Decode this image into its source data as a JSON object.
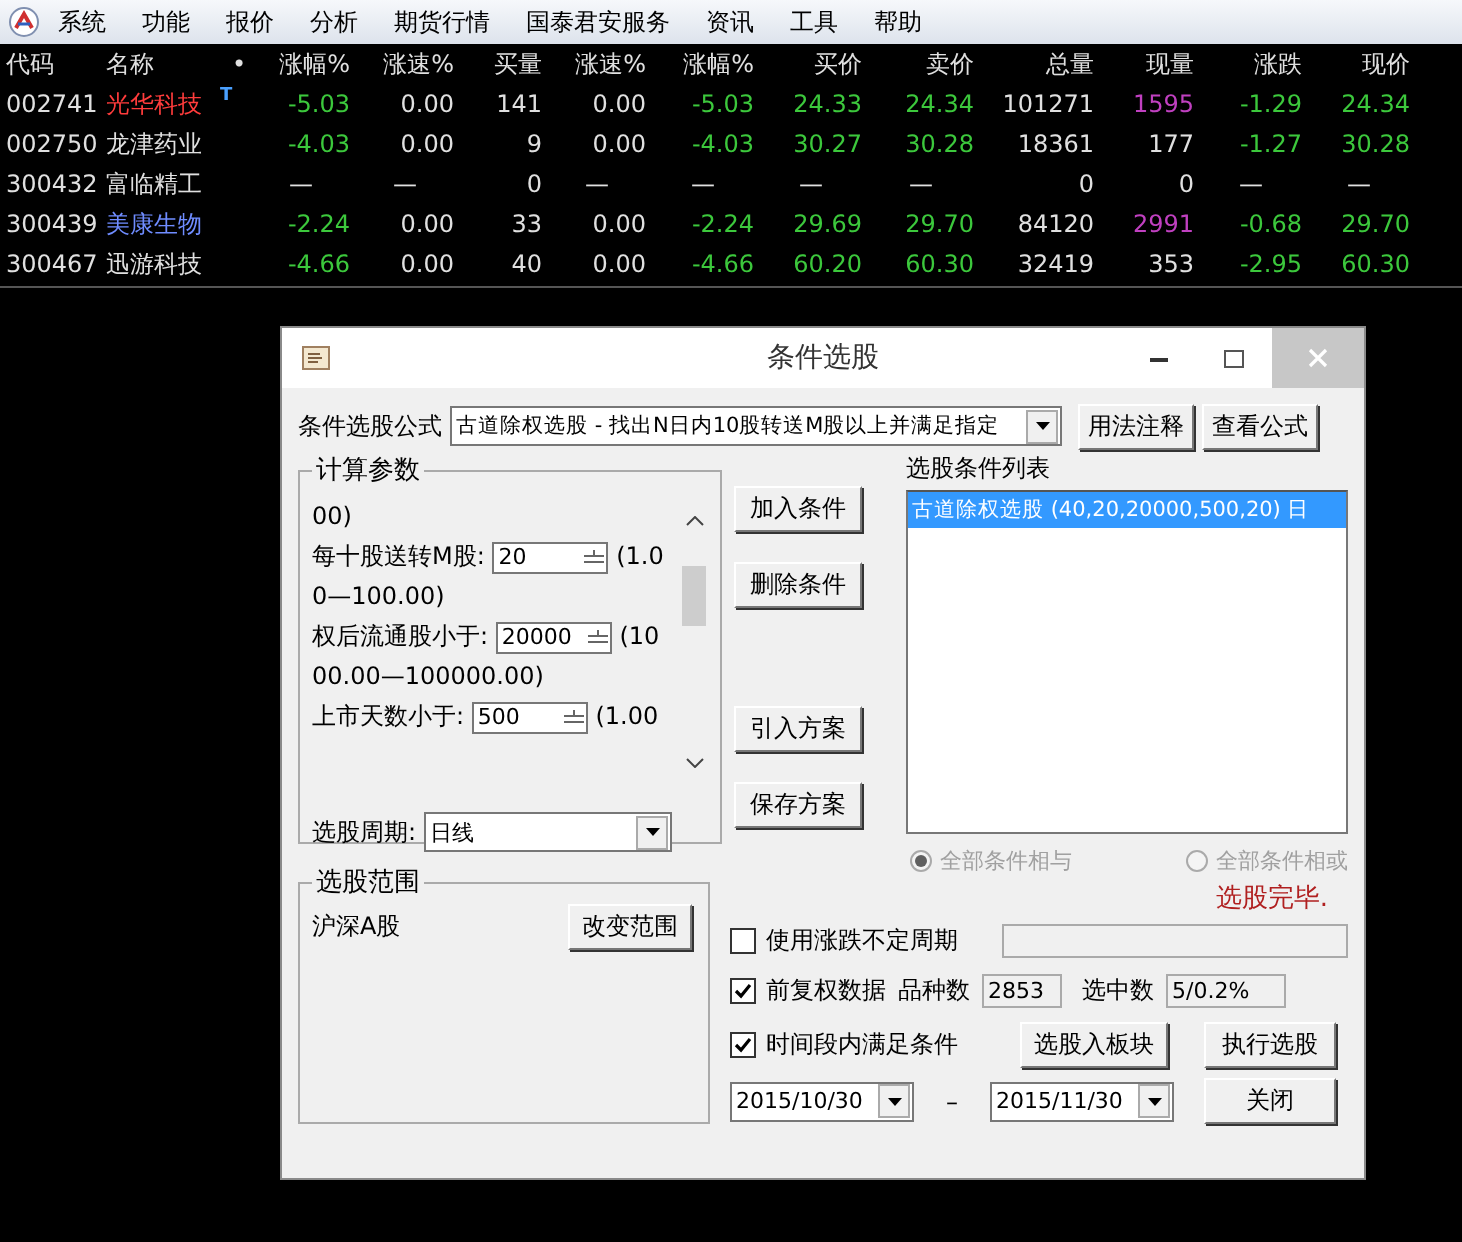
{
  "menu": [
    "系统",
    "功能",
    "报价",
    "分析",
    "期货行情",
    "国泰君安服务",
    "资讯",
    "工具",
    "帮助"
  ],
  "table": {
    "columns": [
      "代码",
      "名称",
      "•",
      "涨幅%",
      "涨速%",
      "买量",
      "涨速%",
      "涨幅%",
      "买价",
      "卖价",
      "总量",
      "现量",
      "涨跌",
      "现价"
    ],
    "rows": [
      {
        "color": "#ff3c3c",
        "cells": [
          {
            "text": "002741",
            "kind": "code"
          },
          {
            "text": "光华科技",
            "kind": "name"
          },
          {
            "text": "T",
            "kind": "flag"
          },
          {
            "text": "-5.03",
            "kind": "fall"
          },
          {
            "text": "0.00",
            "kind": "plain"
          },
          {
            "text": "141",
            "kind": "plain"
          },
          {
            "text": "0.00",
            "kind": "plain"
          },
          {
            "text": "-5.03",
            "kind": "fall"
          },
          {
            "text": "24.33",
            "kind": "fall"
          },
          {
            "text": "24.34",
            "kind": "fall"
          },
          {
            "text": "101271",
            "kind": "plain"
          },
          {
            "text": "1595",
            "kind": "volume"
          },
          {
            "text": "-1.29",
            "kind": "fall"
          },
          {
            "text": "24.34",
            "kind": "fall"
          }
        ]
      },
      {
        "color": "#e0e0e0",
        "cells": [
          {
            "text": "002750",
            "kind": "code"
          },
          {
            "text": "龙津药业",
            "kind": "name"
          },
          {
            "text": ""
          },
          {
            "text": "-4.03",
            "kind": "fall"
          },
          {
            "text": "0.00",
            "kind": "plain"
          },
          {
            "text": "9",
            "kind": "plain"
          },
          {
            "text": "0.00",
            "kind": "plain"
          },
          {
            "text": "-4.03",
            "kind": "fall"
          },
          {
            "text": "30.27",
            "kind": "fall"
          },
          {
            "text": "30.28",
            "kind": "fall"
          },
          {
            "text": "18361",
            "kind": "plain"
          },
          {
            "text": "177",
            "kind": "plain"
          },
          {
            "text": "-1.27",
            "kind": "fall"
          },
          {
            "text": "30.28",
            "kind": "fall"
          }
        ]
      },
      {
        "color": "#e0e0e0",
        "cells": [
          {
            "text": "300432",
            "kind": "code"
          },
          {
            "text": "富临精工",
            "kind": "name"
          },
          {
            "text": ""
          },
          {
            "text": "—",
            "kind": "dash"
          },
          {
            "text": "—",
            "kind": "dash"
          },
          {
            "text": "0",
            "kind": "plain"
          },
          {
            "text": "—",
            "kind": "dash"
          },
          {
            "text": "—",
            "kind": "dash"
          },
          {
            "text": "—",
            "kind": "dash"
          },
          {
            "text": "—",
            "kind": "dash"
          },
          {
            "text": "0",
            "kind": "plain"
          },
          {
            "text": "0",
            "kind": "plain"
          },
          {
            "text": "—",
            "kind": "dash"
          },
          {
            "text": "—",
            "kind": "dash"
          }
        ]
      },
      {
        "color": "#6f8cff",
        "cells": [
          {
            "text": "300439",
            "kind": "code"
          },
          {
            "text": "美康生物",
            "kind": "name"
          },
          {
            "text": ""
          },
          {
            "text": "-2.24",
            "kind": "fall"
          },
          {
            "text": "0.00",
            "kind": "plain"
          },
          {
            "text": "33",
            "kind": "plain"
          },
          {
            "text": "0.00",
            "kind": "plain"
          },
          {
            "text": "-2.24",
            "kind": "fall"
          },
          {
            "text": "29.69",
            "kind": "fall"
          },
          {
            "text": "29.70",
            "kind": "fall"
          },
          {
            "text": "84120",
            "kind": "plain"
          },
          {
            "text": "2991",
            "kind": "volume"
          },
          {
            "text": "-0.68",
            "kind": "fall"
          },
          {
            "text": "29.70",
            "kind": "fall"
          }
        ]
      },
      {
        "color": "#e0e0e0",
        "cells": [
          {
            "text": "300467",
            "kind": "code"
          },
          {
            "text": "迅游科技",
            "kind": "name"
          },
          {
            "text": ""
          },
          {
            "text": "-4.66",
            "kind": "fall"
          },
          {
            "text": "0.00",
            "kind": "plain"
          },
          {
            "text": "40",
            "kind": "plain"
          },
          {
            "text": "0.00",
            "kind": "plain"
          },
          {
            "text": "-4.66",
            "kind": "fall"
          },
          {
            "text": "60.20",
            "kind": "fall"
          },
          {
            "text": "60.30",
            "kind": "fall"
          },
          {
            "text": "32419",
            "kind": "plain"
          },
          {
            "text": "353",
            "kind": "plain"
          },
          {
            "text": "-2.95",
            "kind": "fall"
          },
          {
            "text": "60.30",
            "kind": "fall"
          }
        ]
      }
    ]
  },
  "dialog": {
    "title": "条件选股",
    "formula_label": "条件选股公式",
    "formula": "古道除权选股 - 找出N日内10股转送M股以上并满足指定",
    "formula_buttons": [
      "用法注释",
      "查看公式"
    ],
    "params_group": "计算参数",
    "params_top": "00)",
    "params": [
      {
        "label": "每十股送转M股:",
        "value": "20",
        "range": "(1.0",
        "range_rest": "0—100.00)"
      },
      {
        "label": "权后流通股小于:",
        "value": "20000",
        "range": "(10",
        "range_rest": "00.00—100000.00)"
      },
      {
        "label": "上市天数小于:",
        "value": "500",
        "range": "(1.00"
      }
    ],
    "period_label": "选股周期:",
    "period": "日线",
    "action_buttons": [
      "加入条件",
      "删除条件",
      "引入方案",
      "保存方案"
    ],
    "list_label": "选股条件列表",
    "conditions": [
      {
        "text": "古道除权选股 (40,20,20000,500,20) 日",
        "selected": true
      }
    ],
    "logic": [
      {
        "label": "全部条件相与",
        "selected": true
      },
      {
        "label": "全部条件相或",
        "selected": false
      }
    ],
    "logic_disabled": true,
    "scope_group": "选股范围",
    "scope": "沪深A股",
    "scope_button": "改变范围",
    "status": "选股完毕.",
    "options": [
      {
        "label": "使用涨跌不定周期",
        "checked": false
      },
      {
        "label": "前复权数据",
        "checked": true
      },
      {
        "label": "时间段内满足条件",
        "checked": true
      }
    ],
    "count_label": "品种数",
    "count": "2853",
    "picked_label": "选中数",
    "picked": "5/0.2%",
    "block_button": "选股入板块",
    "run_button": "执行选股",
    "date_from": "2015/10/30",
    "date_sep": "–",
    "date_to": "2015/11/30",
    "close_button": "关闭"
  }
}
